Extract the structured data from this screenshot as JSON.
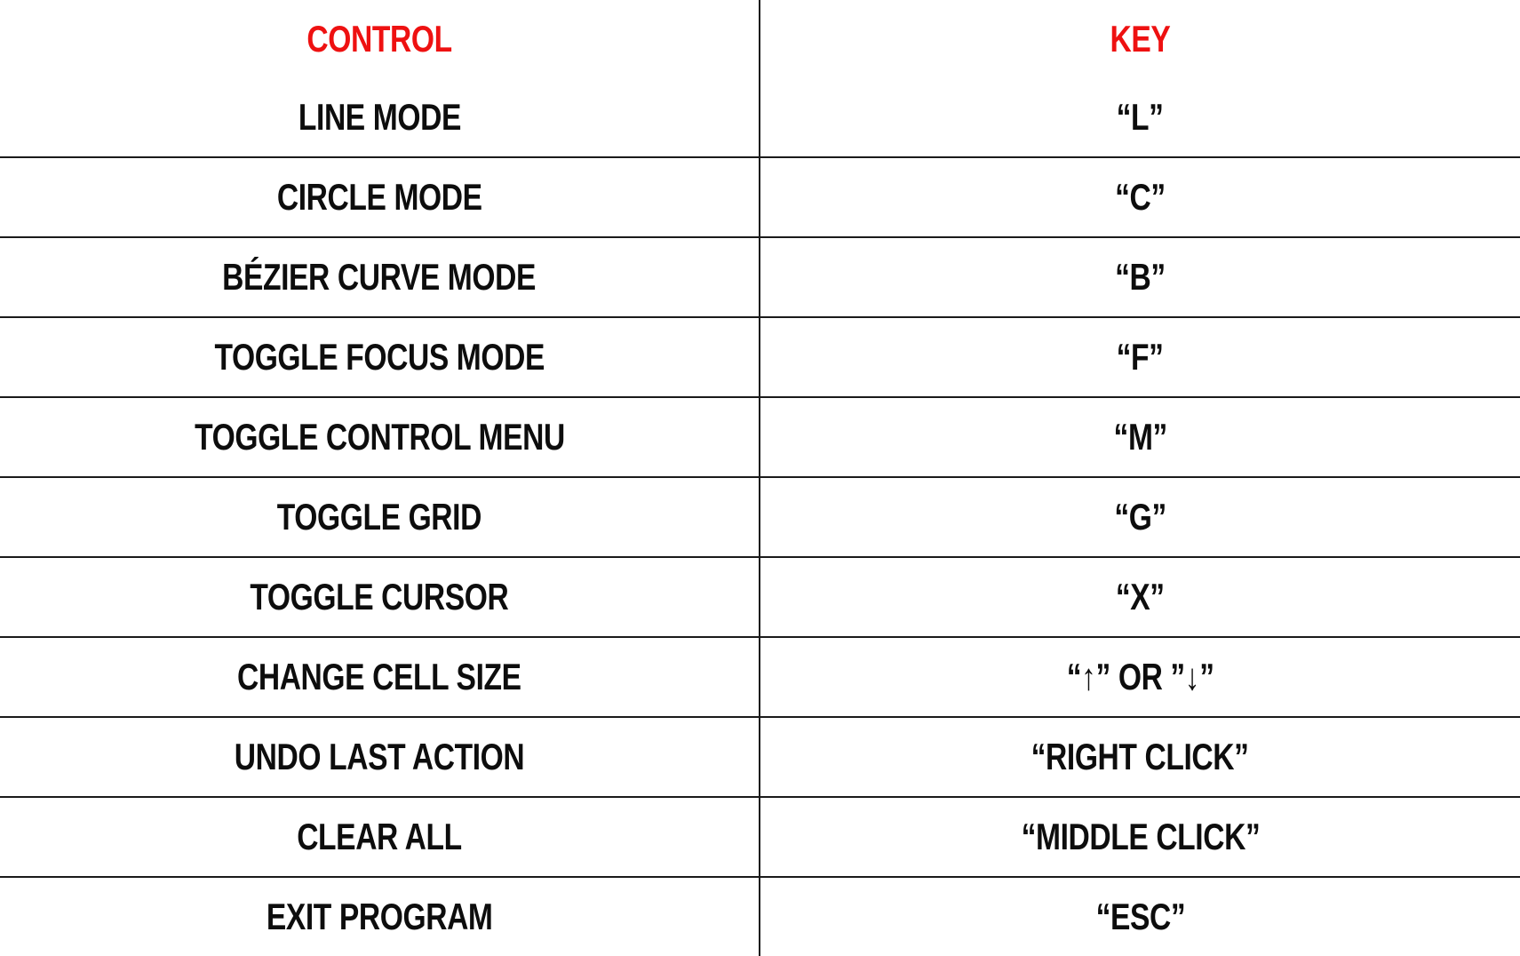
{
  "header": {
    "control_label": "CONTROL",
    "key_label": "KEY",
    "header_color": "#EE1111"
  },
  "rows": [
    {
      "control": "LINE MODE",
      "key": "“L”"
    },
    {
      "control": "CIRCLE MODE",
      "key": "“C”"
    },
    {
      "control": "BÉZIER CURVE MODE",
      "key": "“B”"
    },
    {
      "control": "TOGGLE FOCUS MODE",
      "key": "“F”"
    },
    {
      "control": "TOGGLE CONTROL MENU",
      "key": "“M”"
    },
    {
      "control": "TOGGLE GRID",
      "key": "“G”"
    },
    {
      "control": "TOGGLE CURSOR",
      "key": "“X”"
    },
    {
      "control": "CHANGE CELL SIZE",
      "key": "“↑” OR ”↓”"
    },
    {
      "control": "UNDO LAST ACTION",
      "key": "“RIGHT CLICK”"
    },
    {
      "control": "CLEAR ALL",
      "key": "“MIDDLE CLICK”"
    },
    {
      "control": "EXIT PROGRAM",
      "key": "“ESC”"
    }
  ]
}
